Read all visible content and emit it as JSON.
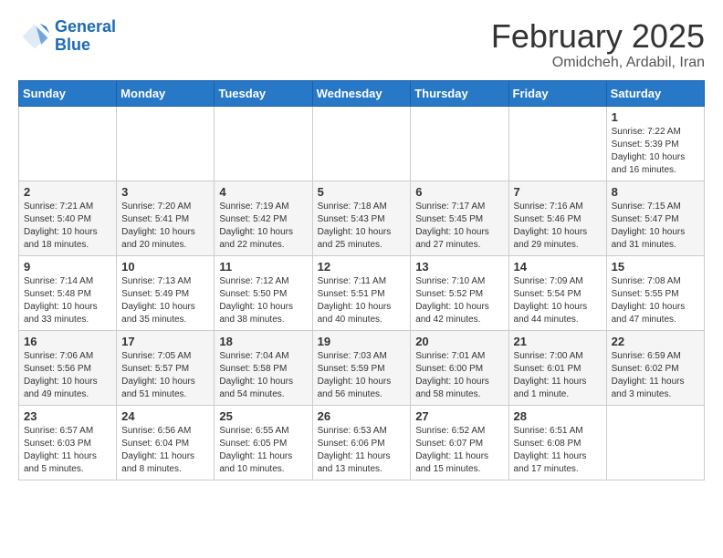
{
  "header": {
    "logo_line1": "General",
    "logo_line2": "Blue",
    "month": "February 2025",
    "location": "Omidcheh, Ardabil, Iran"
  },
  "days_of_week": [
    "Sunday",
    "Monday",
    "Tuesday",
    "Wednesday",
    "Thursday",
    "Friday",
    "Saturday"
  ],
  "weeks": [
    [
      {
        "day": "",
        "info": ""
      },
      {
        "day": "",
        "info": ""
      },
      {
        "day": "",
        "info": ""
      },
      {
        "day": "",
        "info": ""
      },
      {
        "day": "",
        "info": ""
      },
      {
        "day": "",
        "info": ""
      },
      {
        "day": "1",
        "info": "Sunrise: 7:22 AM\nSunset: 5:39 PM\nDaylight: 10 hours\nand 16 minutes."
      }
    ],
    [
      {
        "day": "2",
        "info": "Sunrise: 7:21 AM\nSunset: 5:40 PM\nDaylight: 10 hours\nand 18 minutes."
      },
      {
        "day": "3",
        "info": "Sunrise: 7:20 AM\nSunset: 5:41 PM\nDaylight: 10 hours\nand 20 minutes."
      },
      {
        "day": "4",
        "info": "Sunrise: 7:19 AM\nSunset: 5:42 PM\nDaylight: 10 hours\nand 22 minutes."
      },
      {
        "day": "5",
        "info": "Sunrise: 7:18 AM\nSunset: 5:43 PM\nDaylight: 10 hours\nand 25 minutes."
      },
      {
        "day": "6",
        "info": "Sunrise: 7:17 AM\nSunset: 5:45 PM\nDaylight: 10 hours\nand 27 minutes."
      },
      {
        "day": "7",
        "info": "Sunrise: 7:16 AM\nSunset: 5:46 PM\nDaylight: 10 hours\nand 29 minutes."
      },
      {
        "day": "8",
        "info": "Sunrise: 7:15 AM\nSunset: 5:47 PM\nDaylight: 10 hours\nand 31 minutes."
      }
    ],
    [
      {
        "day": "9",
        "info": "Sunrise: 7:14 AM\nSunset: 5:48 PM\nDaylight: 10 hours\nand 33 minutes."
      },
      {
        "day": "10",
        "info": "Sunrise: 7:13 AM\nSunset: 5:49 PM\nDaylight: 10 hours\nand 35 minutes."
      },
      {
        "day": "11",
        "info": "Sunrise: 7:12 AM\nSunset: 5:50 PM\nDaylight: 10 hours\nand 38 minutes."
      },
      {
        "day": "12",
        "info": "Sunrise: 7:11 AM\nSunset: 5:51 PM\nDaylight: 10 hours\nand 40 minutes."
      },
      {
        "day": "13",
        "info": "Sunrise: 7:10 AM\nSunset: 5:52 PM\nDaylight: 10 hours\nand 42 minutes."
      },
      {
        "day": "14",
        "info": "Sunrise: 7:09 AM\nSunset: 5:54 PM\nDaylight: 10 hours\nand 44 minutes."
      },
      {
        "day": "15",
        "info": "Sunrise: 7:08 AM\nSunset: 5:55 PM\nDaylight: 10 hours\nand 47 minutes."
      }
    ],
    [
      {
        "day": "16",
        "info": "Sunrise: 7:06 AM\nSunset: 5:56 PM\nDaylight: 10 hours\nand 49 minutes."
      },
      {
        "day": "17",
        "info": "Sunrise: 7:05 AM\nSunset: 5:57 PM\nDaylight: 10 hours\nand 51 minutes."
      },
      {
        "day": "18",
        "info": "Sunrise: 7:04 AM\nSunset: 5:58 PM\nDaylight: 10 hours\nand 54 minutes."
      },
      {
        "day": "19",
        "info": "Sunrise: 7:03 AM\nSunset: 5:59 PM\nDaylight: 10 hours\nand 56 minutes."
      },
      {
        "day": "20",
        "info": "Sunrise: 7:01 AM\nSunset: 6:00 PM\nDaylight: 10 hours\nand 58 minutes."
      },
      {
        "day": "21",
        "info": "Sunrise: 7:00 AM\nSunset: 6:01 PM\nDaylight: 11 hours\nand 1 minute."
      },
      {
        "day": "22",
        "info": "Sunrise: 6:59 AM\nSunset: 6:02 PM\nDaylight: 11 hours\nand 3 minutes."
      }
    ],
    [
      {
        "day": "23",
        "info": "Sunrise: 6:57 AM\nSunset: 6:03 PM\nDaylight: 11 hours\nand 5 minutes."
      },
      {
        "day": "24",
        "info": "Sunrise: 6:56 AM\nSunset: 6:04 PM\nDaylight: 11 hours\nand 8 minutes."
      },
      {
        "day": "25",
        "info": "Sunrise: 6:55 AM\nSunset: 6:05 PM\nDaylight: 11 hours\nand 10 minutes."
      },
      {
        "day": "26",
        "info": "Sunrise: 6:53 AM\nSunset: 6:06 PM\nDaylight: 11 hours\nand 13 minutes."
      },
      {
        "day": "27",
        "info": "Sunrise: 6:52 AM\nSunset: 6:07 PM\nDaylight: 11 hours\nand 15 minutes."
      },
      {
        "day": "28",
        "info": "Sunrise: 6:51 AM\nSunset: 6:08 PM\nDaylight: 11 hours\nand 17 minutes."
      },
      {
        "day": "",
        "info": ""
      }
    ]
  ]
}
